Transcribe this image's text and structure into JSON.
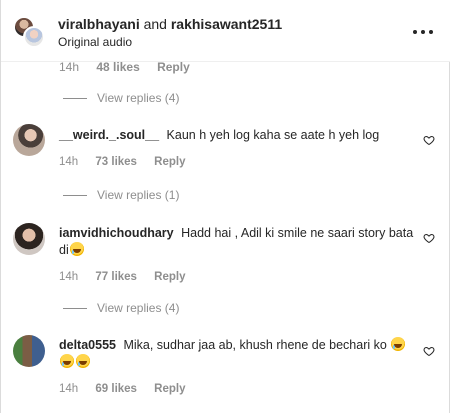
{
  "header": {
    "user1": "viralbhayani",
    "joiner": "and",
    "user2": "rakhisawant2511",
    "subtitle": "Original audio"
  },
  "partial_meta": {
    "time": "14h",
    "likes": "48 likes",
    "reply": "Reply"
  },
  "replies_1": "View replies (4)",
  "comments": [
    {
      "username": "__weird._.soul__",
      "text": "Kaun h yeh log kaha se aate h yeh log",
      "time": "14h",
      "likes": "73 likes",
      "reply": "Reply",
      "view_replies": "View replies (1)"
    },
    {
      "username": "iamvidhichoudhary",
      "text": "Hadd hai , Adil ki smile ne saari story bata di",
      "time": "14h",
      "likes": "77 likes",
      "reply": "Reply",
      "view_replies": "View replies (4)"
    },
    {
      "username": "delta0555",
      "text": "Mika, sudhar jaa ab, khush rhene de bechari ko",
      "time": "14h",
      "likes": "69 likes",
      "reply": "Reply"
    }
  ],
  "icons": {
    "more": "more-horizontal-icon",
    "like": "heart-outline-icon",
    "emoji": "grinning-sweat-emoji"
  }
}
